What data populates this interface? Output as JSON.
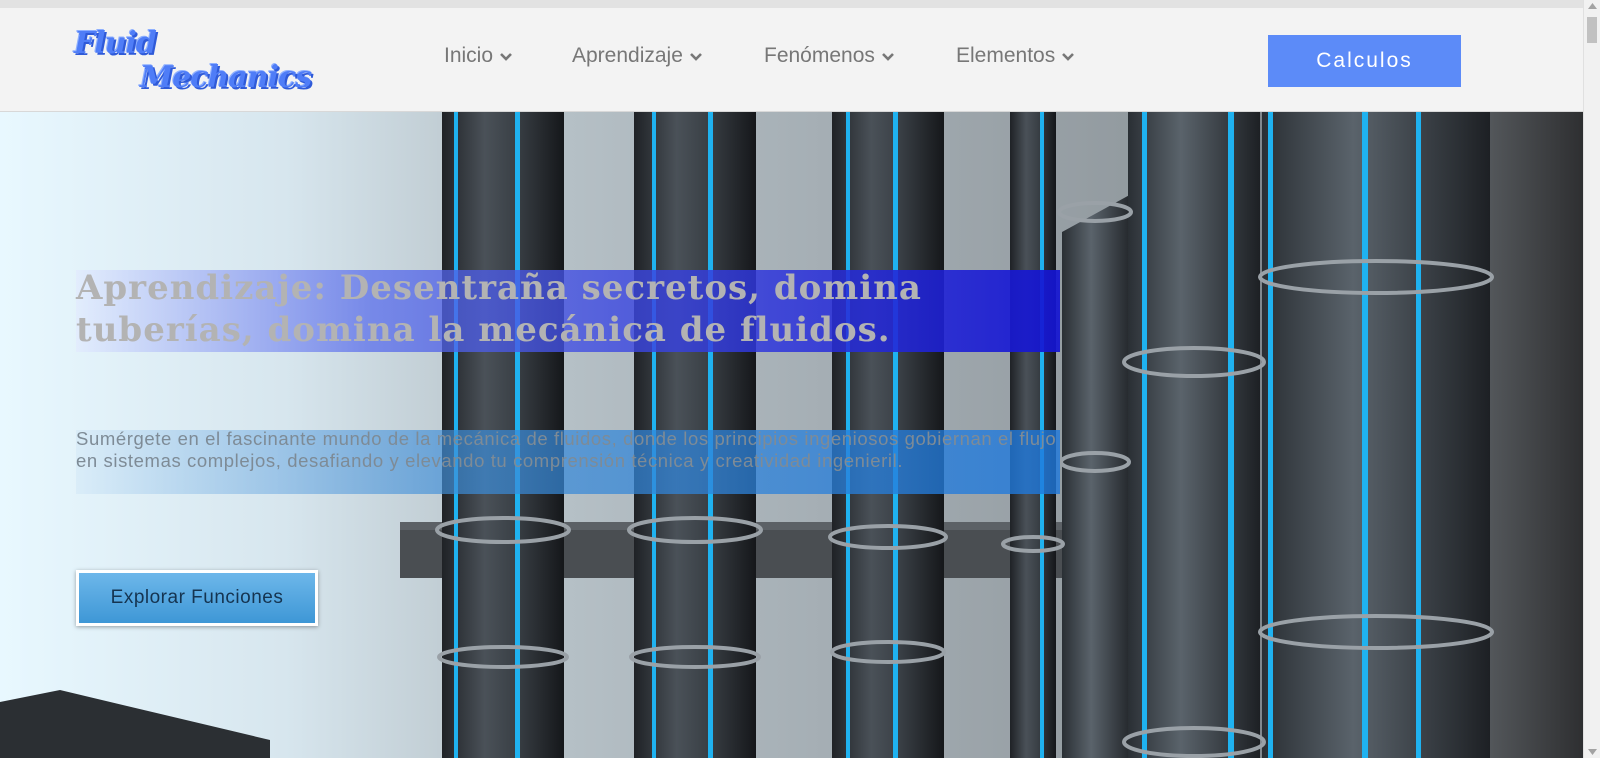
{
  "logo": {
    "line1": "Fluid",
    "line2": "Mechanics"
  },
  "nav": {
    "items": [
      {
        "label": "Inicio"
      },
      {
        "label": "Aprendizaje"
      },
      {
        "label": "Fenómenos"
      },
      {
        "label": "Elementos"
      }
    ],
    "cta_label": "Calculos"
  },
  "hero": {
    "headline": "Aprendizaje: Desentraña secretos, domina tuberías, domina la mecánica de fluidos.",
    "subtext": "Sumérgete en el fascinante mundo de la mecánica de fluidos, donde los principios ingeniosos gobiernan el flujo en sistemas complejos, desafiando y elevando tu comprensión técnica y creatividad ingenieril.",
    "button_label": "Explorar Funciones",
    "background_image": "industrial-pipes-photo"
  },
  "colors": {
    "accent": "#5c8bf8",
    "logo": "#4f7df7",
    "header_bg": "#f3f3f3",
    "nav_text": "#777777",
    "headline_band": "#1414d2",
    "button": "#3e97d6"
  },
  "icons": {
    "nav_chevron": "chevron-down-icon",
    "scroll_up": "scroll-up-arrow-icon",
    "scroll_down": "scroll-down-arrow-icon"
  }
}
